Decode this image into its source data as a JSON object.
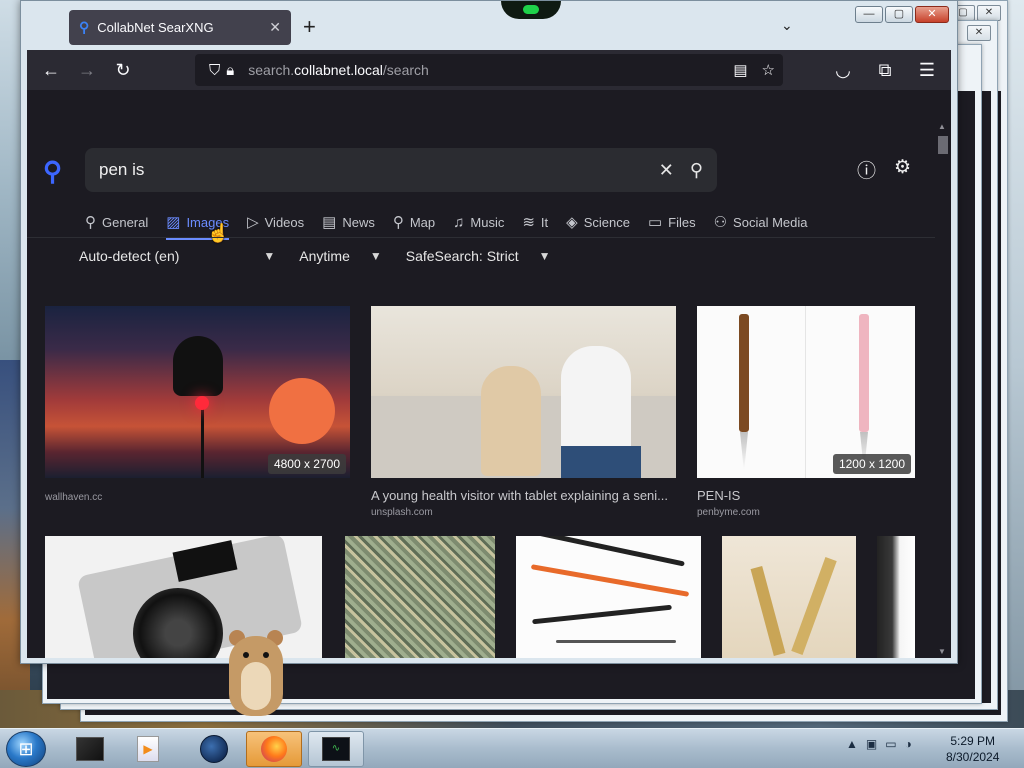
{
  "browser": {
    "tab_title": "CollabNet SearXNG",
    "tab_close": "✕",
    "new_tab": "+",
    "tabs_menu": "⌄",
    "url_prefix": "search.",
    "url_domain": "collabnet.local",
    "url_path": "/search",
    "caption": {
      "minimize": "—",
      "maximize": "▢",
      "close": "✕"
    }
  },
  "search": {
    "query": "pen is",
    "clear_icon": "✕",
    "search_icon": "⚲"
  },
  "categories": [
    {
      "label": "General",
      "icon": "⚲",
      "active": false
    },
    {
      "label": "Images",
      "icon": "▨",
      "active": true
    },
    {
      "label": "Videos",
      "icon": "▷",
      "active": false
    },
    {
      "label": "News",
      "icon": "▤",
      "active": false
    },
    {
      "label": "Map",
      "icon": "⚲",
      "active": false
    },
    {
      "label": "Music",
      "icon": "♫",
      "active": false
    },
    {
      "label": "It",
      "icon": "≋",
      "active": false
    },
    {
      "label": "Science",
      "icon": "◈",
      "active": false
    },
    {
      "label": "Files",
      "icon": "▭",
      "active": false
    },
    {
      "label": "Social Media",
      "icon": "⚇",
      "active": false
    }
  ],
  "filters": {
    "language": "Auto-detect (en)",
    "time": "Anytime",
    "safesearch": "SafeSearch: Strict"
  },
  "results": [
    {
      "title": "",
      "url": "wallhaven.cc",
      "size": "4800 x 2700"
    },
    {
      "title": "A young health visitor with tablet explaining a seni...",
      "url": "unsplash.com",
      "size": ""
    },
    {
      "title": "PEN-IS",
      "url": "penbyme.com",
      "size": "1200 x 1200"
    }
  ],
  "taskbar": {
    "time": "5:29 PM",
    "date": "8/30/2024",
    "tray_arrow": "▲"
  },
  "colors": {
    "accent": "#6b8cff",
    "page_bg": "#1c1b22",
    "toolbar_bg": "#2b2a33"
  }
}
